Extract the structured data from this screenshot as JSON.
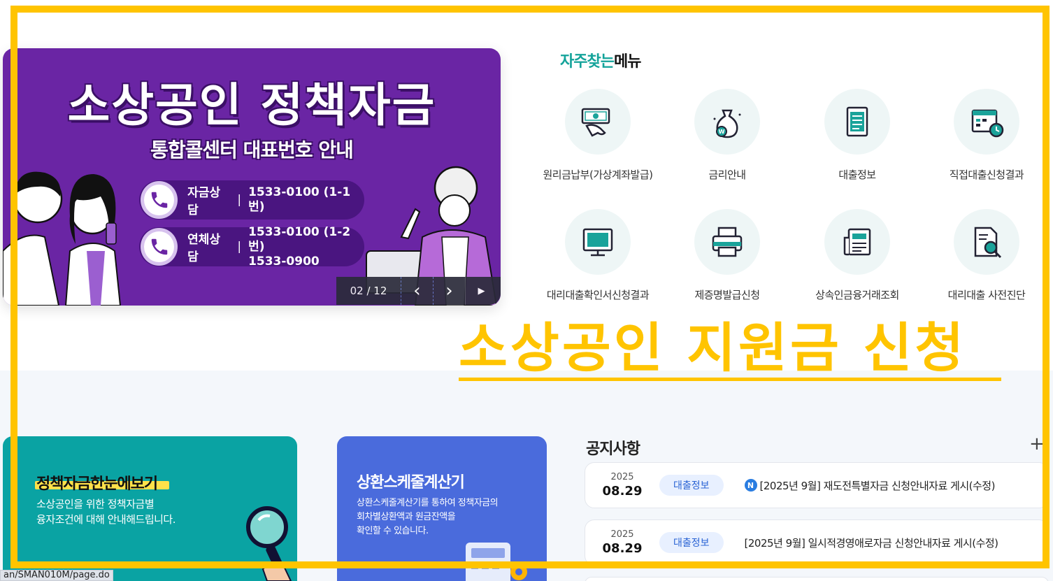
{
  "banner": {
    "title": "소상공인 정책자금",
    "subtitle": "통합콜센터 대표번호 안내",
    "line1": {
      "label": "자금상담",
      "sep": "|",
      "number": "1533-0100 (1-1번)"
    },
    "line2": {
      "label": "연체상담",
      "sep": "|",
      "number1": "1533-0100 (1-2번)",
      "number2": "1533-0900"
    },
    "slider": {
      "counter": "02 / 12",
      "prev": "‹",
      "next": "›",
      "play": "▶"
    }
  },
  "frequent_menu": {
    "title_accent": "자주찾는",
    "title_rest": "메뉴",
    "items": [
      {
        "label": "원리금납부(가상계좌발급)",
        "icon": "money-hand-icon"
      },
      {
        "label": "금리안내",
        "icon": "money-bag-icon"
      },
      {
        "label": "대출정보",
        "icon": "document-list-icon"
      },
      {
        "label": "직접대출신청결과",
        "icon": "calendar-clock-icon"
      },
      {
        "label": "대리대출확인서신청결과",
        "icon": "monitor-icon"
      },
      {
        "label": "제증명발급신청",
        "icon": "printer-icon"
      },
      {
        "label": "상속인금융거래조회",
        "icon": "newspaper-icon"
      },
      {
        "label": "대리대출 사전진단",
        "icon": "document-search-icon"
      }
    ]
  },
  "overlay": {
    "headline": "소상공인 지원금 신청"
  },
  "cards": {
    "policy": {
      "title": "정책자금한눈에보기",
      "desc1": "소상공인을 위한 정책자금별",
      "desc2": "융자조건에 대해 안내해드립니다."
    },
    "schedule": {
      "title": "상환스케줄계산기",
      "desc1": "상환스케줄계산기를 통하여 정책자금의",
      "desc2": "회차별상환액과 원금잔액을",
      "desc3": "확인할 수 있습니다."
    }
  },
  "notices": {
    "title": "공지사항",
    "more": "+",
    "items": [
      {
        "year": "2025",
        "date": "08.29",
        "category": "대출정보",
        "is_new": "N",
        "text": "[2025년 9월] 재도전특별자금 신청안내자료 게시(수정)"
      },
      {
        "year": "2025",
        "date": "08.29",
        "category": "대출정보",
        "text": "[2025년 9월] 일시적경영애로자금 신청안내자료 게시(수정)"
      }
    ]
  },
  "status_bar": {
    "url": "an/SMAN010M/page.do"
  },
  "colors": {
    "banner_purple": "#6a25a4",
    "teal": "#14a39a",
    "frame_yellow": "#ffc400",
    "card_teal": "#0aa3a3",
    "card_blue": "#4a6bdc"
  }
}
